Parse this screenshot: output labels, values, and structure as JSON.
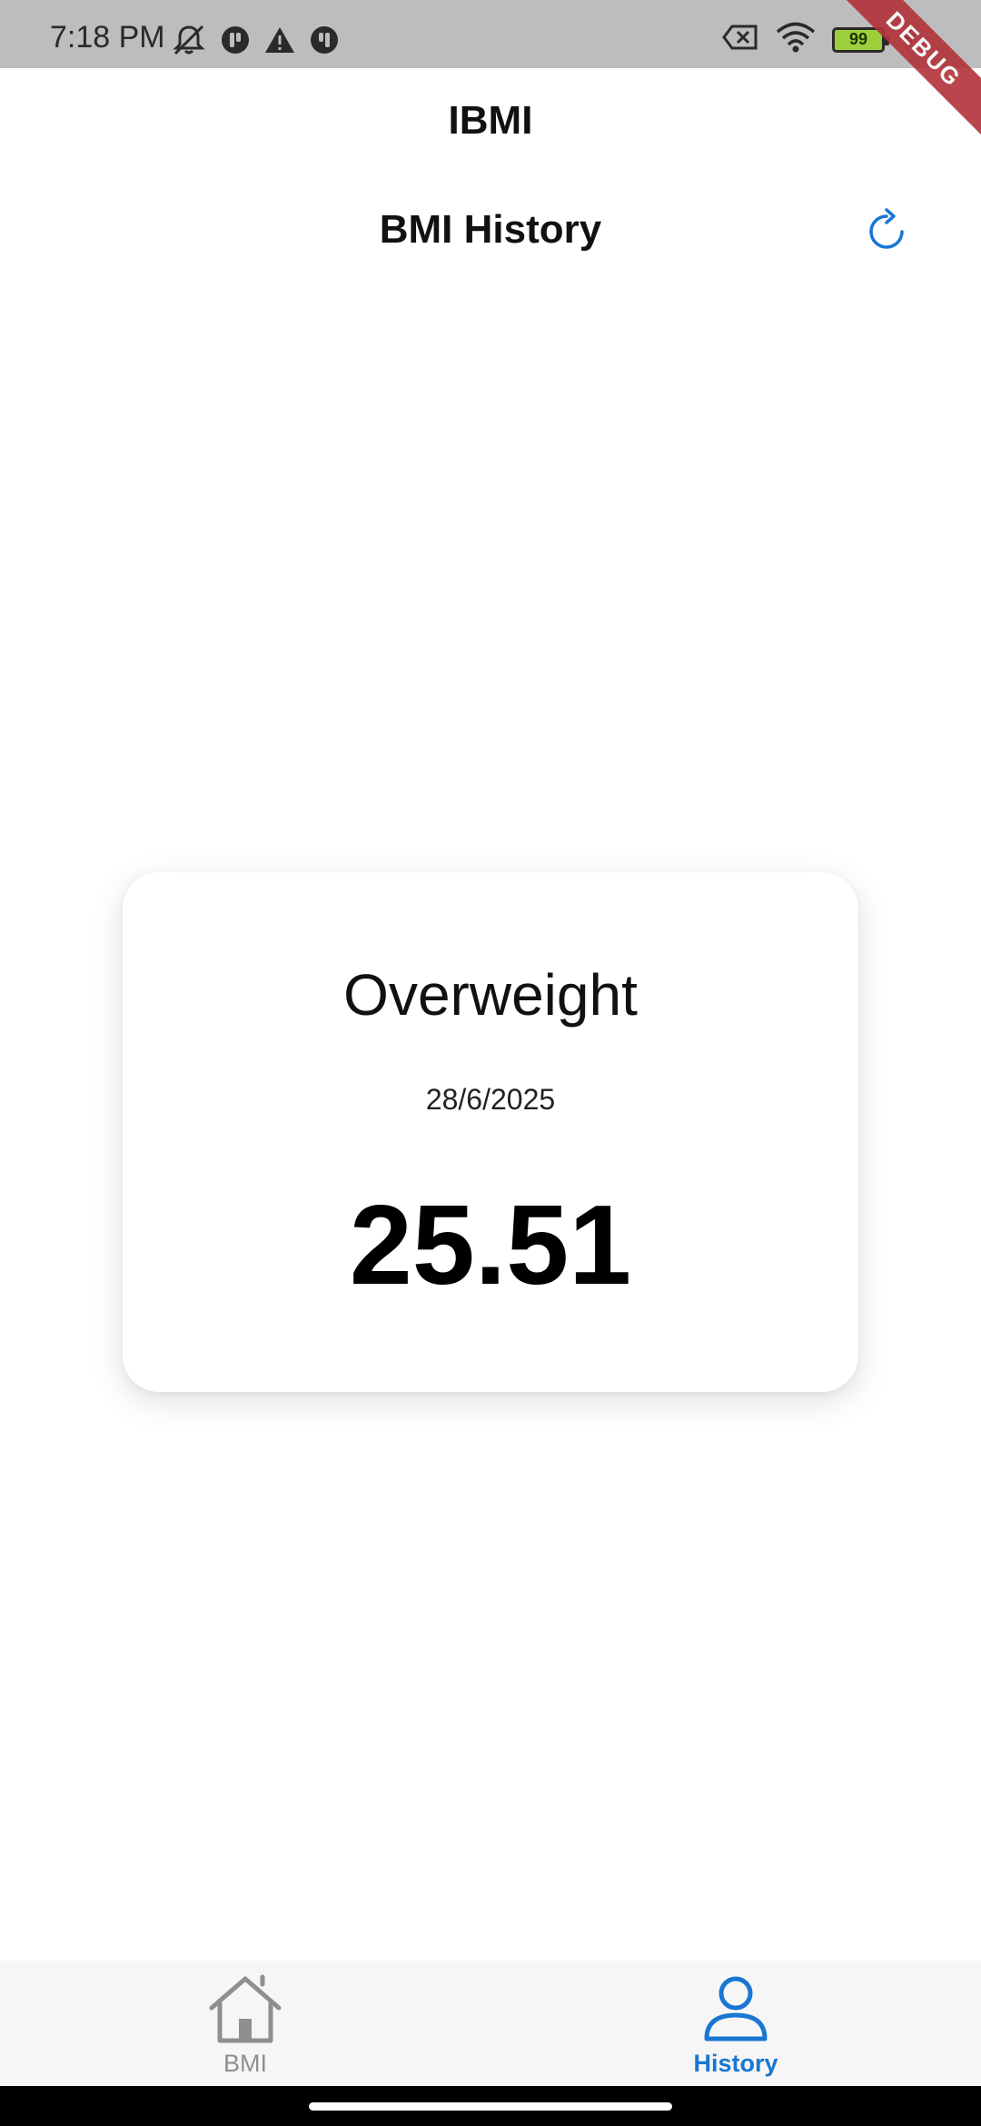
{
  "status_bar": {
    "time": "7:18 PM",
    "left_icons": [
      "muted-bell-icon",
      "app-notification-icon",
      "warning-icon",
      "app-notification-icon"
    ],
    "right_icons": [
      "no-sim-icon",
      "wifi-icon",
      "battery-icon",
      "charging-icon"
    ],
    "battery_level": "99",
    "battery_color": "#9ccf3c"
  },
  "debug_banner": "DEBUG",
  "header": {
    "app_title": "IBMI",
    "page_title": "BMI History",
    "refresh_icon": "refresh-icon",
    "accent_color": "#1976d2"
  },
  "history_card": {
    "category": "Overweight",
    "date": "28/6/2025",
    "bmi_value": "25.51"
  },
  "bottom_nav": {
    "items": [
      {
        "label": "BMI",
        "icon": "home-icon",
        "active": false
      },
      {
        "label": "History",
        "icon": "person-icon",
        "active": true
      }
    ],
    "active_color": "#1976d2",
    "inactive_color": "#8f8f8f"
  }
}
